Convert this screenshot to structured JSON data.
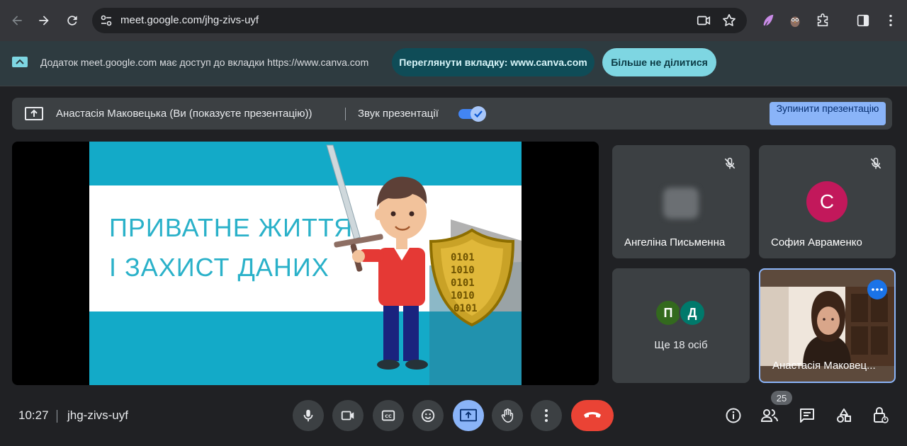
{
  "browser": {
    "url": "meet.google.com/jhg-zivs-uyf"
  },
  "infobar": {
    "message": "Додаток meet.google.com має доступ до вкладки https://www.canva.com",
    "view_tab_label": "Переглянути вкладку: www.canva.com",
    "stop_sharing_label": "Більше не ділитися"
  },
  "presentation_bar": {
    "presenter": "Анастасія Маковецька (Ви (показуєте презентацію))",
    "sound_label": "Звук презентації",
    "sound_enabled": true,
    "stop_label": "Зупинити презентацію"
  },
  "slide": {
    "line1": "ПРИВАТНЕ ЖИТТЯ",
    "line2": "І ЗАХИСТ ДАНИХ",
    "shield_binary": [
      "0101",
      "1010",
      "0101",
      "1010",
      "0101"
    ]
  },
  "participants": [
    {
      "name": "Ангеліна Письменна",
      "muted": true
    },
    {
      "name": "София Авраменко",
      "muted": true,
      "initial": "С",
      "color": "#c2185b"
    },
    {
      "more_label": "Ще 18 осіб",
      "initials": [
        "П",
        "Д"
      ],
      "colors": [
        "#33691e",
        "#00796b"
      ]
    },
    {
      "name": "Анастасія Маковец...",
      "is_self": true
    }
  ],
  "bottom": {
    "time": "10:27",
    "meeting_code": "jhg-zivs-uyf",
    "participant_count": "25"
  },
  "colors": {
    "end_call": "#ea4335",
    "present_active": "#8ab4f8",
    "accent": "#1a73e8"
  }
}
